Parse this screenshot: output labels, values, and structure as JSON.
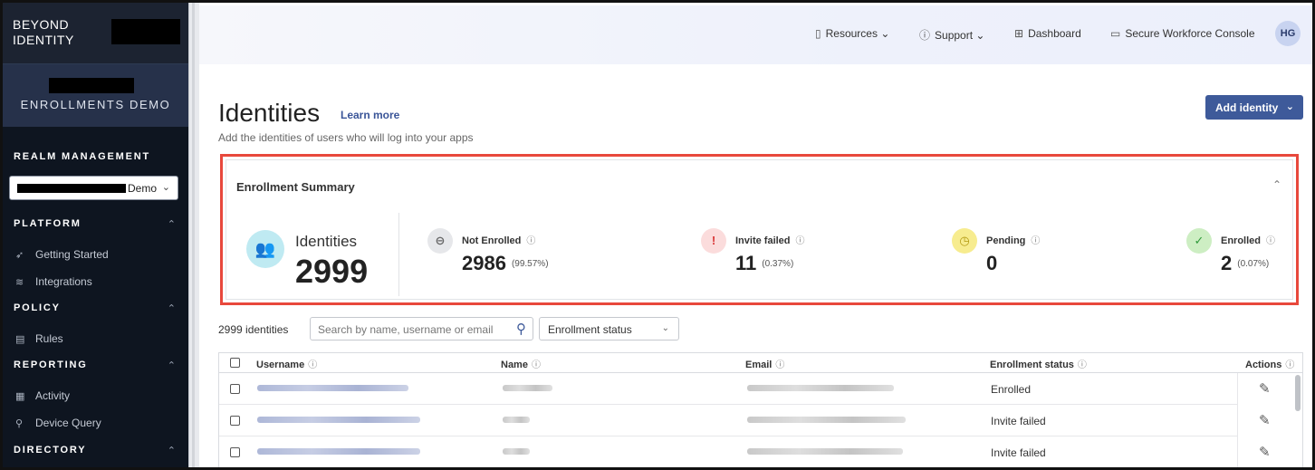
{
  "sidebar": {
    "logo_line1": "BEYOND",
    "logo_line2": "IDENTITY",
    "tenant_name": "ENROLLMENTS DEMO",
    "realm_title": "REALM MANAGEMENT",
    "realm_select_value": "Demo",
    "groups": [
      {
        "title": "PLATFORM",
        "items": [
          "Getting Started",
          "Integrations"
        ]
      },
      {
        "title": "POLICY",
        "items": [
          "Rules"
        ]
      },
      {
        "title": "REPORTING",
        "items": [
          "Activity",
          "Device Query"
        ]
      },
      {
        "title": "DIRECTORY",
        "items": []
      }
    ]
  },
  "topbar": {
    "resources": "Resources",
    "support": "Support",
    "dashboard": "Dashboard",
    "console": "Secure Workforce Console",
    "avatar_initials": "HG"
  },
  "page": {
    "title": "Identities",
    "learn_more": "Learn more",
    "subtitle": "Add the identities of users who will log into your apps",
    "add_button": "Add identity"
  },
  "summary": {
    "title": "Enrollment Summary",
    "identities_label": "Identities",
    "identities_value": "2999",
    "stats": [
      {
        "label": "Not Enrolled",
        "value": "2986",
        "pct": "(99.57%)",
        "color": "#e6e7ea",
        "icon_color": "#666"
      },
      {
        "label": "Invite failed",
        "value": "11",
        "pct": "(0.37%)",
        "color": "#fbdcdc",
        "icon_color": "#d93636"
      },
      {
        "label": "Pending",
        "value": "0",
        "pct": "",
        "color": "#f7ec8f",
        "icon_color": "#b39a12"
      },
      {
        "label": "Enrolled",
        "value": "2",
        "pct": "(0.07%)",
        "color": "#cdeec3",
        "icon_color": "#2f9a3a"
      }
    ]
  },
  "toolbar": {
    "count": "2999 identities",
    "search_placeholder": "Search by name, username or email",
    "status_filter": "Enrollment status"
  },
  "table": {
    "headers": [
      "Username",
      "Name",
      "Email",
      "Enrollment status",
      "Actions"
    ],
    "rows": [
      {
        "status": "Enrolled"
      },
      {
        "status": "Invite failed"
      },
      {
        "status": "Invite failed"
      }
    ]
  }
}
